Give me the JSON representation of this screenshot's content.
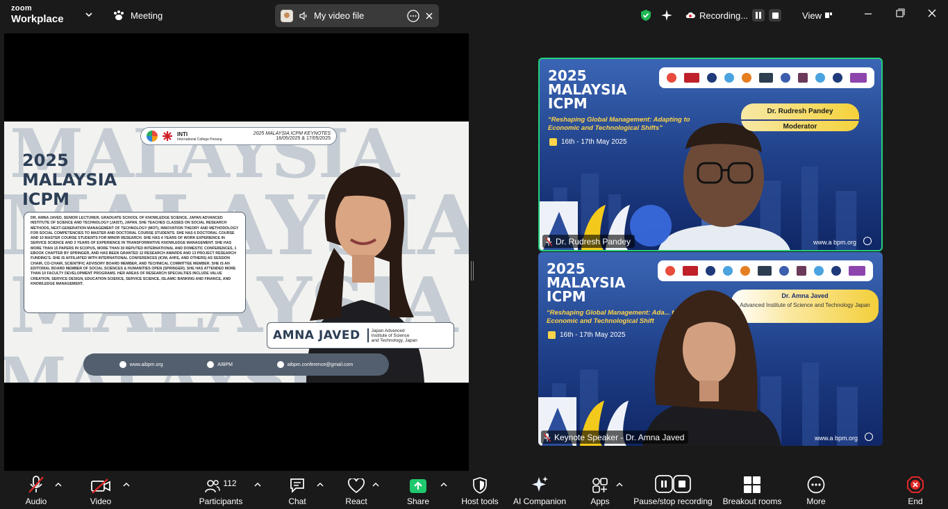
{
  "app": {
    "brand_top": "zoom",
    "brand_bottom": "Workplace",
    "meeting_label": "Meeting"
  },
  "share_pill": {
    "title": "My video file"
  },
  "top_right": {
    "recording_label": "Recording...",
    "view_label": "View"
  },
  "slide": {
    "header_org": "INTI",
    "header_org_sub": "International College Penang",
    "header_event": "2025 MALAYSIA ICPM KEYNOTES",
    "header_dates": "16/05/2025 & 17/05/2025",
    "title_line1": "2025",
    "title_line2": "MALAYSIA",
    "title_line3": "ICPM",
    "background_word": "MALAYSIA",
    "bio": "DR. AMNA JAVED, SENIOR LECTURER, GRADUATE SCHOOL OF KNOWLEDGE SCIENCE, JAPAN ADVANCED INSTITUTE OF SCIENCE AND TECHNOLOGY (JAIST), JAPAN. SHE TEACHES CLASSES ON SOCIAL RESEARCH METHODS, NEXT-GENERATION MANAGEMENT OF TECHNOLOGY (MOT), INNOVATION THEORY AND METHODOLOGY FOR SOCIAL COMPETENCIES TO MASTER AND DOCTORAL COURSE STUDENTS. SHE HAS 6 DOCTORAL COURSE AND 10 MASTER COURSE STUDENTS FOR MINOR RESEARCH. SHE HAS 4 YEARS OF WORK EXPERIENCE IN SERVICE SCIENCE AND 3 YEARS OF EXPERIENCE IN TRANSFORMATIVE KNOWLEDGE MANAGEMENT. SHE HAS MORE THAN 15 PAPERS IN SCOPUS, MORE THAN 30 REPUTED INTERNATIONAL AND DOMESTIC CONFERENCES, 1 EBOOK CHAPTER BY SPRINGER, AND HAS BEEN GRANTED 12 RESEARCH AWARDS AND 13 PROJECT RESEARCH FUNDING'S. SHE IS AFFILIATED WITH INTERNATIONAL CONFERENCES (ICIM, AHFE, AND OTHERS) AS SESSION CHAIR, CO-CHAIR, SCIENTIFIC ADVISORY BOARD MEMBER, AND TECHNICAL COMMITTEE MEMBER. SHE IS AN EDITORIAL BOARD MEMBER OF SOCIAL SCIENCES & HUMANITIES OPEN (SPRINGER). SHE HAS ATTENDED MORE THAN 10 FACULTY DEVELOPMENT PROGRAMS. HER AREAS OF RESEARCH SPECIALTIES INCLUDE VALUE CREATION, SERVICE DESIGN, EDUCATION SCIENCE, SERVICE SCIENCE, ISLAMIC BANKING AND FINANCE, AND KNOWLEDGE MANAGEMENT.",
    "speaker_name": "AMNA JAVED",
    "speaker_aff_1": "Japan Advanced",
    "speaker_aff_2": "Institute of Science",
    "speaker_aff_3": "and Technology, Japan",
    "contact_web": "www.aibpm.org",
    "contact_social": "AIBPM",
    "contact_email": "aibpm.conference@gmail.com"
  },
  "tiles": [
    {
      "title1": "2025",
      "title2": "MALAYSIA",
      "title3": "ICPM",
      "theme": "“Reshaping Global Management: Adapting to Economic and Technological Shifts”",
      "date": "16th - 17th May 2025",
      "card_name": "Dr. Rudresh Pandey",
      "card_role": "Moderator",
      "web": "www.a bpm.org",
      "participant": "Dr. Rudresh Pandey"
    },
    {
      "title1": "2025",
      "title2": "MALAYSIA",
      "title3": "ICPM",
      "theme": "“Reshaping Global Management: Ada... to Economic and Technological Shift",
      "date": "16th - 17th May 2025",
      "card_name": "Dr. Amna Javed",
      "card_role": "Advanced Institute of Science and Technology Japan",
      "web": "www.a bpm.org",
      "participant": "Keynote Speaker - Dr. Amna Javed"
    }
  ],
  "toolbar": {
    "audio": "Audio",
    "video": "Video",
    "participants": "Participants",
    "participants_count": "112",
    "chat": "Chat",
    "react": "React",
    "share": "Share",
    "host_tools": "Host tools",
    "ai_companion": "AI Companion",
    "apps": "Apps",
    "pause_stop": "Pause/stop recording",
    "breakout": "Breakout rooms",
    "more": "More",
    "end": "End"
  },
  "colors": {
    "active_speaker_border": "#22d07a",
    "share_green": "#1fc86c",
    "end_red": "#e02828",
    "shield_green": "#1fb855"
  }
}
